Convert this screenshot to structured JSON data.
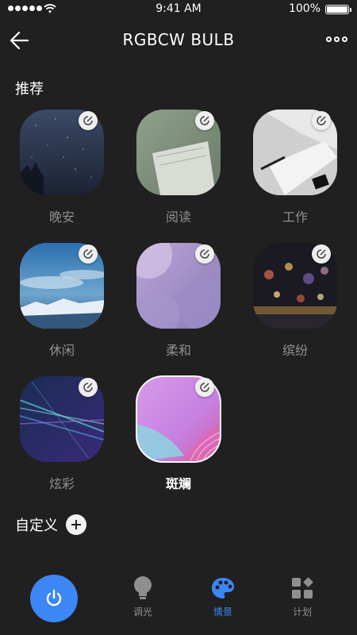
{
  "status_bar": {
    "time": "9:41 AM",
    "battery": "100%"
  },
  "header": {
    "title": "RGBCW BULB"
  },
  "recommended": {
    "title": "推荐",
    "scenes": [
      {
        "label": "晚安"
      },
      {
        "label": "阅读"
      },
      {
        "label": "工作"
      },
      {
        "label": "休闲"
      },
      {
        "label": "柔和"
      },
      {
        "label": "缤纷"
      },
      {
        "label": "炫彩"
      },
      {
        "label": "斑斓",
        "selected": true
      }
    ]
  },
  "custom": {
    "title": "自定义"
  },
  "tabbar": {
    "tabs": [
      {
        "label": "调光",
        "icon": "bulb-icon"
      },
      {
        "label": "情景",
        "icon": "palette-icon",
        "active": true
      },
      {
        "label": "计划",
        "icon": "schedule-icon"
      }
    ]
  },
  "colors": {
    "accent": "#3d86f5",
    "background": "#202020"
  }
}
